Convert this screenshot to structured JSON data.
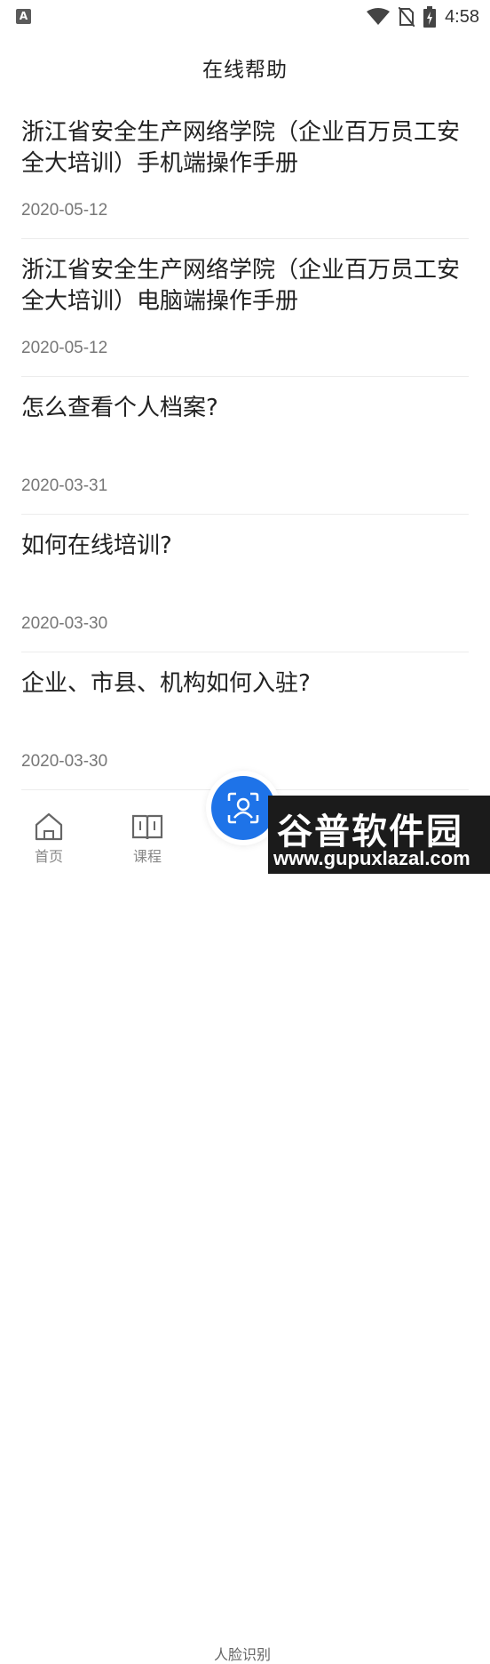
{
  "status_bar": {
    "app_icon_letter": "A",
    "time": "4:58"
  },
  "header": {
    "title": "在线帮助"
  },
  "articles": [
    {
      "title": "浙江省安全生产网络学院（企业百万员工安全大培训）手机端操作手册",
      "date": "2020-05-12"
    },
    {
      "title": "浙江省安全生产网络学院（企业百万员工安全大培训）电脑端操作手册",
      "date": "2020-05-12"
    },
    {
      "title": "怎么查看个人档案?",
      "date": "2020-03-31"
    },
    {
      "title": "如何在线培训?",
      "date": "2020-03-30"
    },
    {
      "title": "企业、市县、机构如何入驻?",
      "date": "2020-03-30"
    }
  ],
  "tab_bar": {
    "home_label": "首页",
    "course_label": "课程",
    "face_label": "人脸识别"
  },
  "watermark": {
    "brand": "谷普软件园",
    "url": "www.gupuxlazal.com"
  },
  "colors": {
    "accent": "#1e73e8",
    "date_text": "#777777",
    "divider": "#ececec"
  }
}
